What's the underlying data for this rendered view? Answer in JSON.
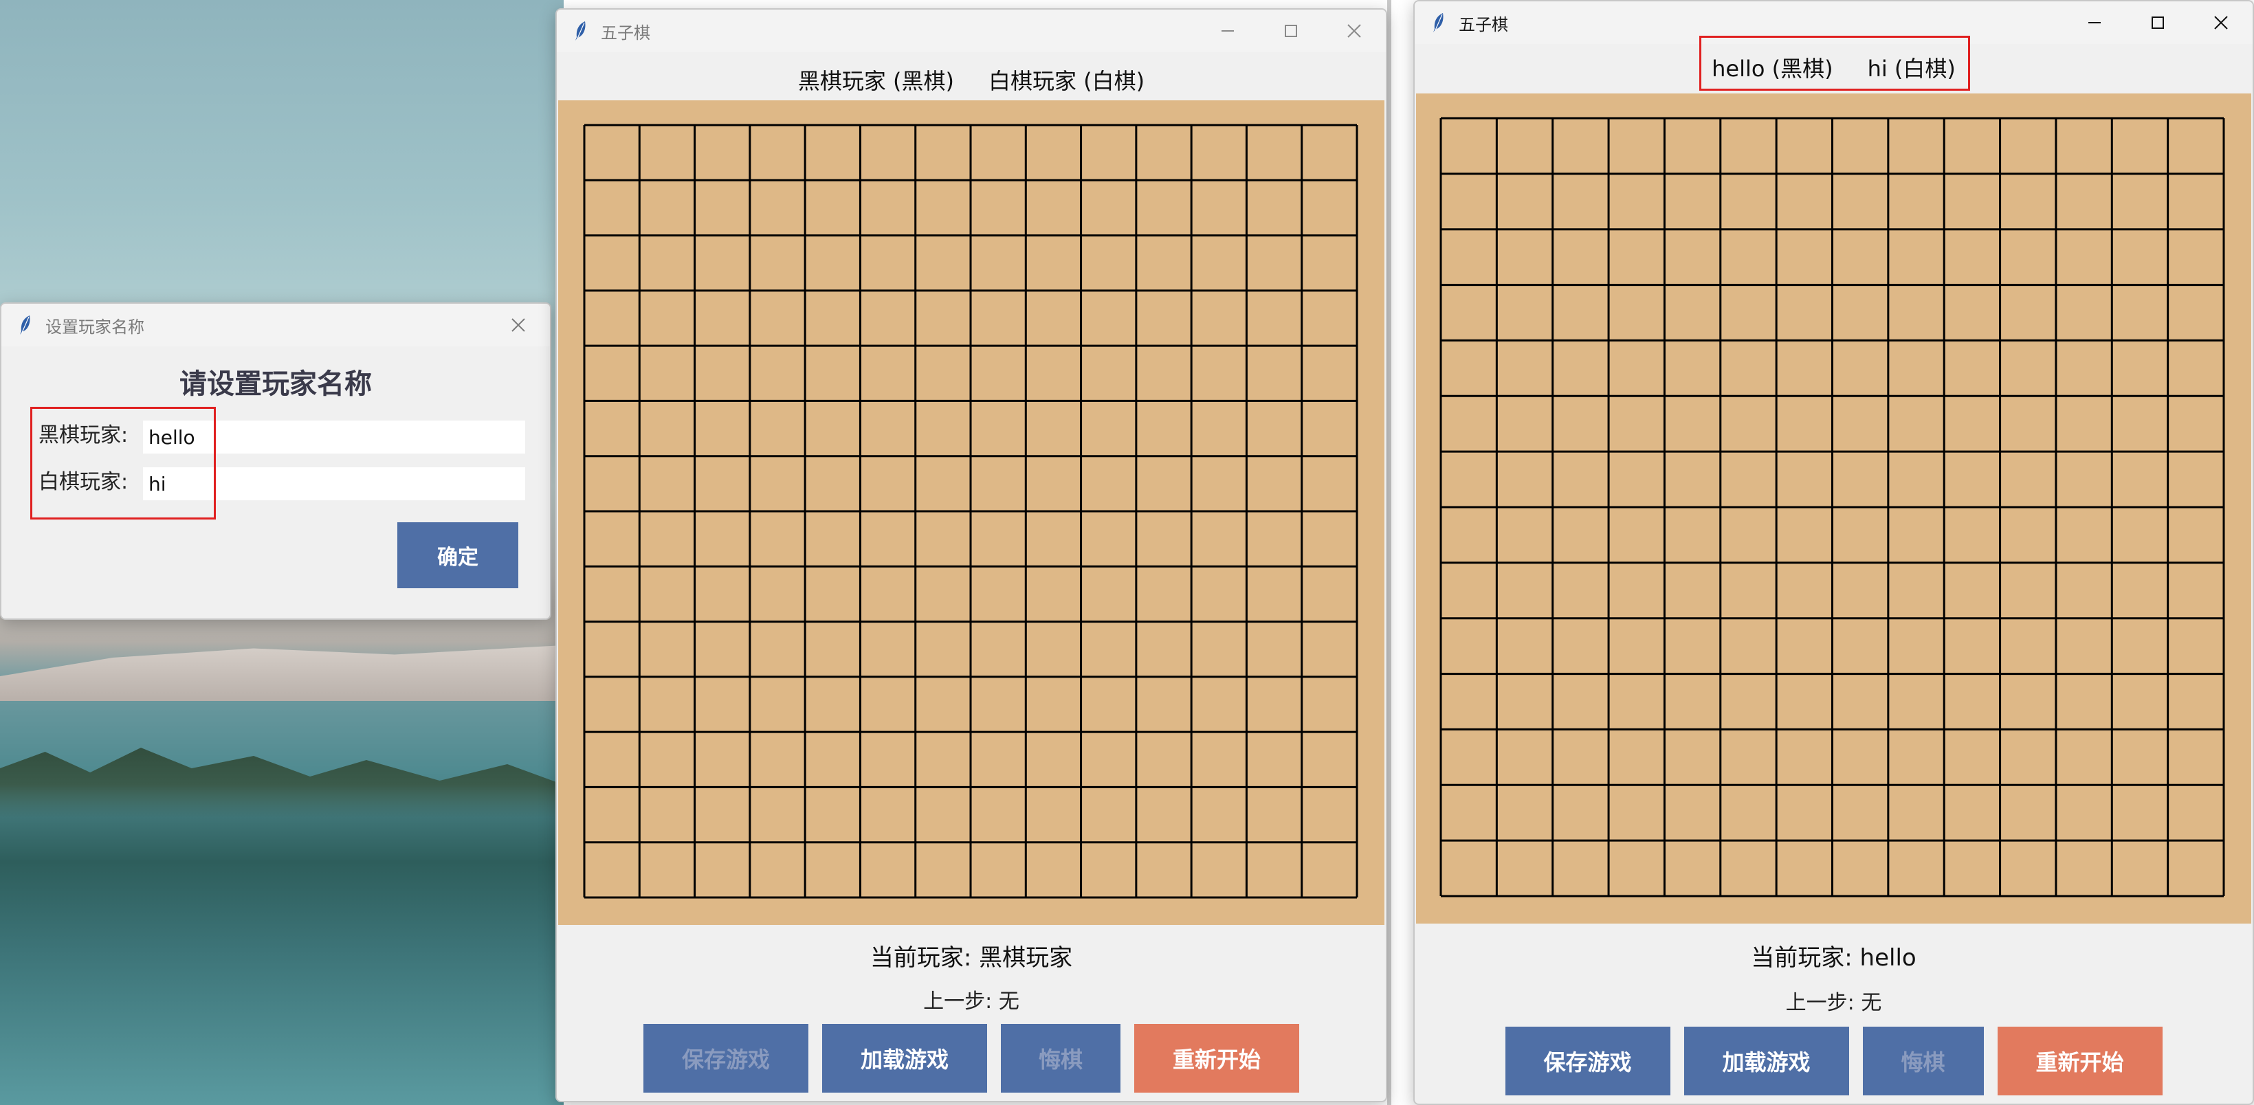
{
  "dialog": {
    "title": "设置玩家名称",
    "heading": "请设置玩家名称",
    "black_label": "黑棋玩家:",
    "black_value": "hello",
    "white_label": "白棋玩家:",
    "white_value": "hi",
    "confirm_label": "确定"
  },
  "game_before": {
    "title": "五子棋",
    "black_player": "黑棋玩家 (黑棋)",
    "white_player": "白棋玩家 (白棋)",
    "current_player": "当前玩家: 黑棋玩家",
    "last_move": "上一步: 无",
    "buttons": {
      "save": "保存游戏",
      "load": "加载游戏",
      "undo": "悔棋",
      "restart": "重新开始"
    }
  },
  "game_after": {
    "title": "五子棋",
    "black_player": "hello (黑棋)",
    "white_player": "hi (白棋)",
    "current_player_prefix": "当前玩家: ",
    "current_player_name": "hello",
    "last_move": "上一步: 无",
    "buttons": {
      "save": "保存游戏",
      "load": "加载游戏",
      "undo": "悔棋",
      "restart": "重新开始"
    }
  },
  "board": {
    "grid_lines": 15,
    "color": "#deb887",
    "line_color": "#000000"
  },
  "colors": {
    "button_blue": "#4f6fa6",
    "button_orange": "#e27a5e",
    "highlight_red": "#e02020"
  },
  "icons": {
    "app": "feather-icon",
    "minimize": "minimize-icon",
    "maximize": "maximize-icon",
    "close": "close-icon"
  }
}
